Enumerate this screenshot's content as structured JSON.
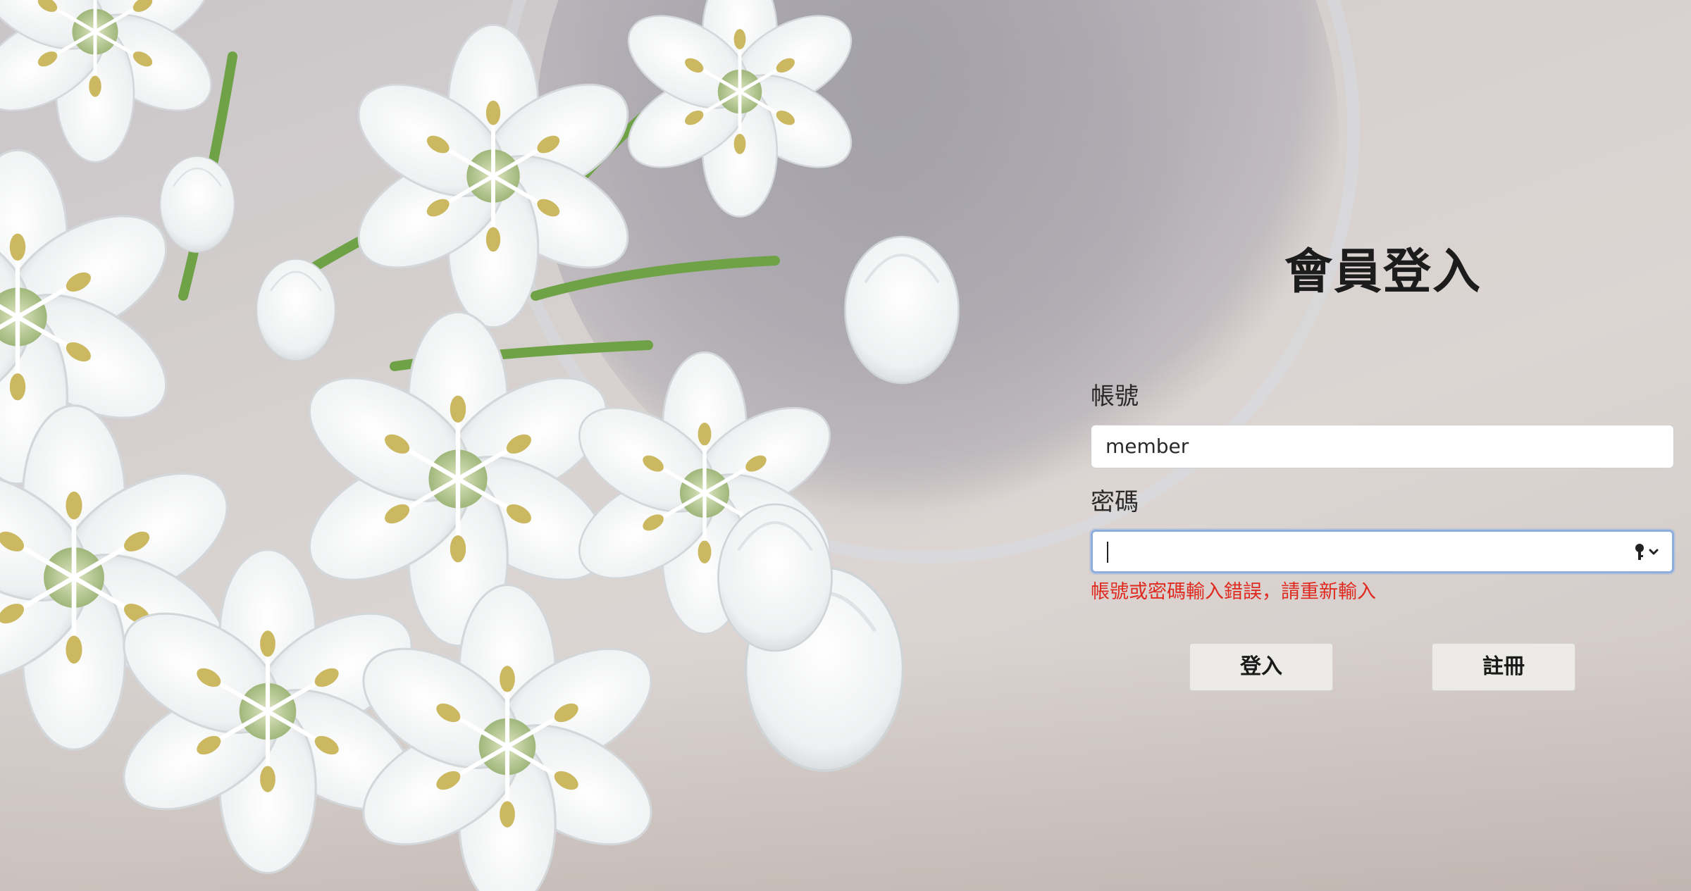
{
  "login_form": {
    "title": "會員登入",
    "account_label": "帳號",
    "account_value": "member",
    "password_label": "密碼",
    "password_value": "",
    "error_message": "帳號或密碼輸入錯誤，請重新輸入",
    "login_button": "登入",
    "register_button": "註冊"
  },
  "colors": {
    "error": "#e02a20",
    "focus_border": "#8eaee0",
    "button_bg": "#ecebe8",
    "title": "#1c1c1c"
  },
  "icons": {
    "password_field": "key-icon"
  }
}
